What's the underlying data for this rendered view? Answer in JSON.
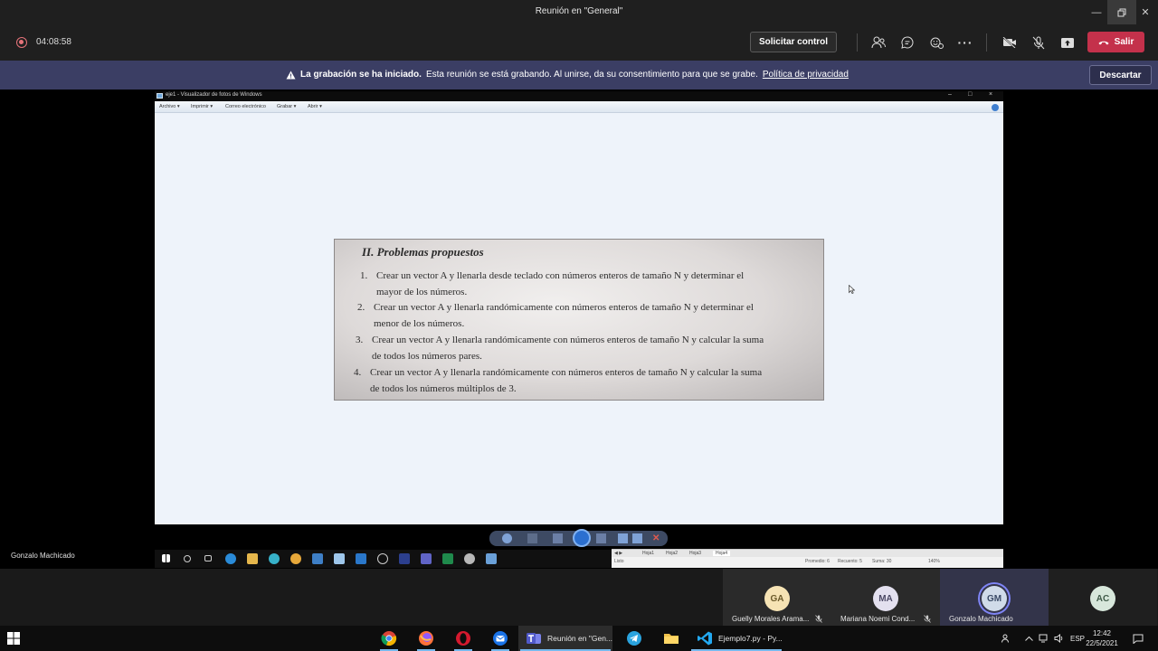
{
  "window": {
    "title": "Reunión en \"General\"",
    "controls": [
      "minimize",
      "restore",
      "close"
    ]
  },
  "meeting_toolbar": {
    "recording_time": "04:08:58",
    "request_control_label": "Solicitar control",
    "leave_label": "Salir",
    "icons": [
      "participants-icon",
      "chat-icon",
      "reactions-icon",
      "more-icon",
      "camera-off-icon",
      "mic-off-icon",
      "share-icon"
    ]
  },
  "banner": {
    "bold_text": "La grabación se ha iniciado.",
    "text": "Esta reunión se está grabando. Al unirse, da su consentimiento para que se grabe.",
    "link_text": "Política de privacidad",
    "dismiss_label": "Descartar"
  },
  "shared_screen": {
    "viewer_title": "eje1 - Visualizador de fotos de Windows",
    "menu": [
      "Archivo",
      "Imprimir",
      "Correo electrónico",
      "Grabar",
      "Abrir"
    ],
    "photo": {
      "title": "II. Problemas propuestos",
      "problems": [
        {
          "num": "1.",
          "line1": "Crear un vector A y llenarla desde teclado con números enteros de tamaño N y determinar el",
          "line2": "mayor de los números."
        },
        {
          "num": "2.",
          "line1": "Crear un vector A y llenarla randómicamente con números enteros de tamaño N y determinar el",
          "line2": "menor de los números."
        },
        {
          "num": "3.",
          "line1": "Crear un vector A y llenarla randómicamente con números enteros de tamaño N y calcular la suma",
          "line2": "de todos los números pares."
        },
        {
          "num": "4.",
          "line1": "Crear un vector A y llenarla randómicamente con números enteros de tamaño N y calcular la suma",
          "line2": "de todos los números múltiplos de 3."
        }
      ]
    },
    "excel": {
      "sheets": [
        "Hoja1",
        "Hoja2",
        "Hoja3",
        "Hoja4"
      ],
      "status_left": "Listo",
      "status_promedio": "Promedio: 6",
      "status_recuento": "Recuento: 5",
      "status_suma": "Suma: 30",
      "zoom": "140%"
    },
    "presenter": "Gonzalo Machicado"
  },
  "participants": [
    {
      "initials": "GA",
      "name": "Guelly Morales Arama...",
      "color": "#f6e3b4",
      "text_color": "#6b5a2a",
      "muted": true
    },
    {
      "initials": "MA",
      "name": "Mariana Noemi Cond...",
      "color": "#e3e0ef",
      "text_color": "#4d4a66",
      "muted": true
    },
    {
      "initials": "GM",
      "name": "Gonzalo Machicado",
      "color": "#d0dbe9",
      "text_color": "#3a4a66",
      "muted": false,
      "speaking": true
    },
    {
      "initials": "AC",
      "name": "",
      "color": "#d7e7db",
      "text_color": "#3f5a48",
      "muted": false
    }
  ],
  "taskbar": {
    "apps": [
      {
        "name": "chrome-icon",
        "label": ""
      },
      {
        "name": "firefox-icon",
        "label": ""
      },
      {
        "name": "opera-icon",
        "label": ""
      },
      {
        "name": "mail-icon",
        "label": ""
      },
      {
        "name": "teams-icon",
        "label": "Reunión en \"Gen..."
      },
      {
        "name": "telegram-icon",
        "label": ""
      },
      {
        "name": "file-explorer-icon",
        "label": ""
      },
      {
        "name": "vscode-icon",
        "label": "Ejemplo7.py - Py..."
      }
    ],
    "lang": "ESP",
    "time": "12:42",
    "date": "22/5/2021"
  },
  "colors": {
    "leave": "#c4314b",
    "banner": "#3b3e64",
    "background": "#1f1f1f"
  }
}
